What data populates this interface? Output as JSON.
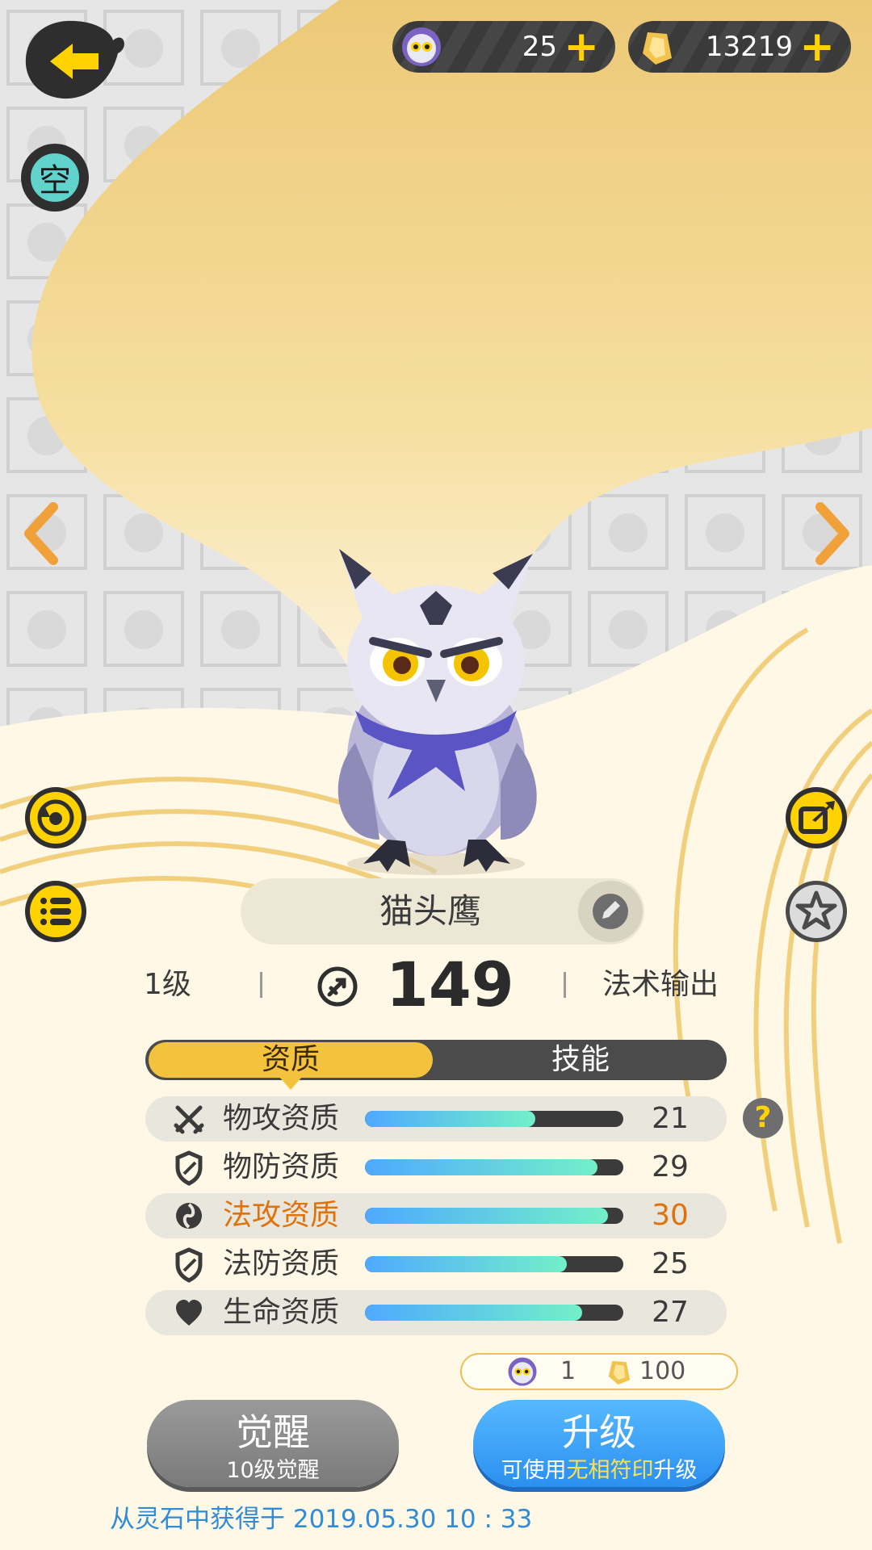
{
  "top_bar": {
    "owl_token_count": "25",
    "crystal_count": "13219",
    "plus_glyph": "+"
  },
  "element_badge": "空",
  "pet": {
    "name": "猫头鹰",
    "level": "1级",
    "power": "149",
    "role": "法术输出"
  },
  "tabs": {
    "active": "资质",
    "inactive": "技能"
  },
  "attributes": [
    {
      "label": "物攻资质",
      "value": "21",
      "fill": 0.66,
      "icon": "crossed-swords-icon",
      "highlight": false
    },
    {
      "label": "物防资质",
      "value": "29",
      "fill": 0.9,
      "icon": "shield-icon",
      "highlight": false
    },
    {
      "label": "法攻资质",
      "value": "30",
      "fill": 0.94,
      "icon": "swirl-icon",
      "highlight": true
    },
    {
      "label": "法防资质",
      "value": "25",
      "fill": 0.78,
      "icon": "shield-icon",
      "highlight": false
    },
    {
      "label": "生命资质",
      "value": "27",
      "fill": 0.84,
      "icon": "heart-icon",
      "highlight": false
    }
  ],
  "help_glyph": "?",
  "cost": {
    "owl_token": "1",
    "crystal": "100"
  },
  "buttons": {
    "awaken_title": "觉醒",
    "awaken_sub": "10级觉醒",
    "upgrade_title": "升级",
    "upgrade_sub_a": "可使用",
    "upgrade_sub_b": "无相符印",
    "upgrade_sub_c": "升级"
  },
  "footer": "从灵石中获得于 2019.05.30   10 : 33",
  "colors": {
    "accent": "#f4c33d",
    "highlight": "#e0720c",
    "upgrade": "#2b8ff0",
    "bar_start": "#4fa9ff",
    "bar_end": "#72f0c9"
  }
}
